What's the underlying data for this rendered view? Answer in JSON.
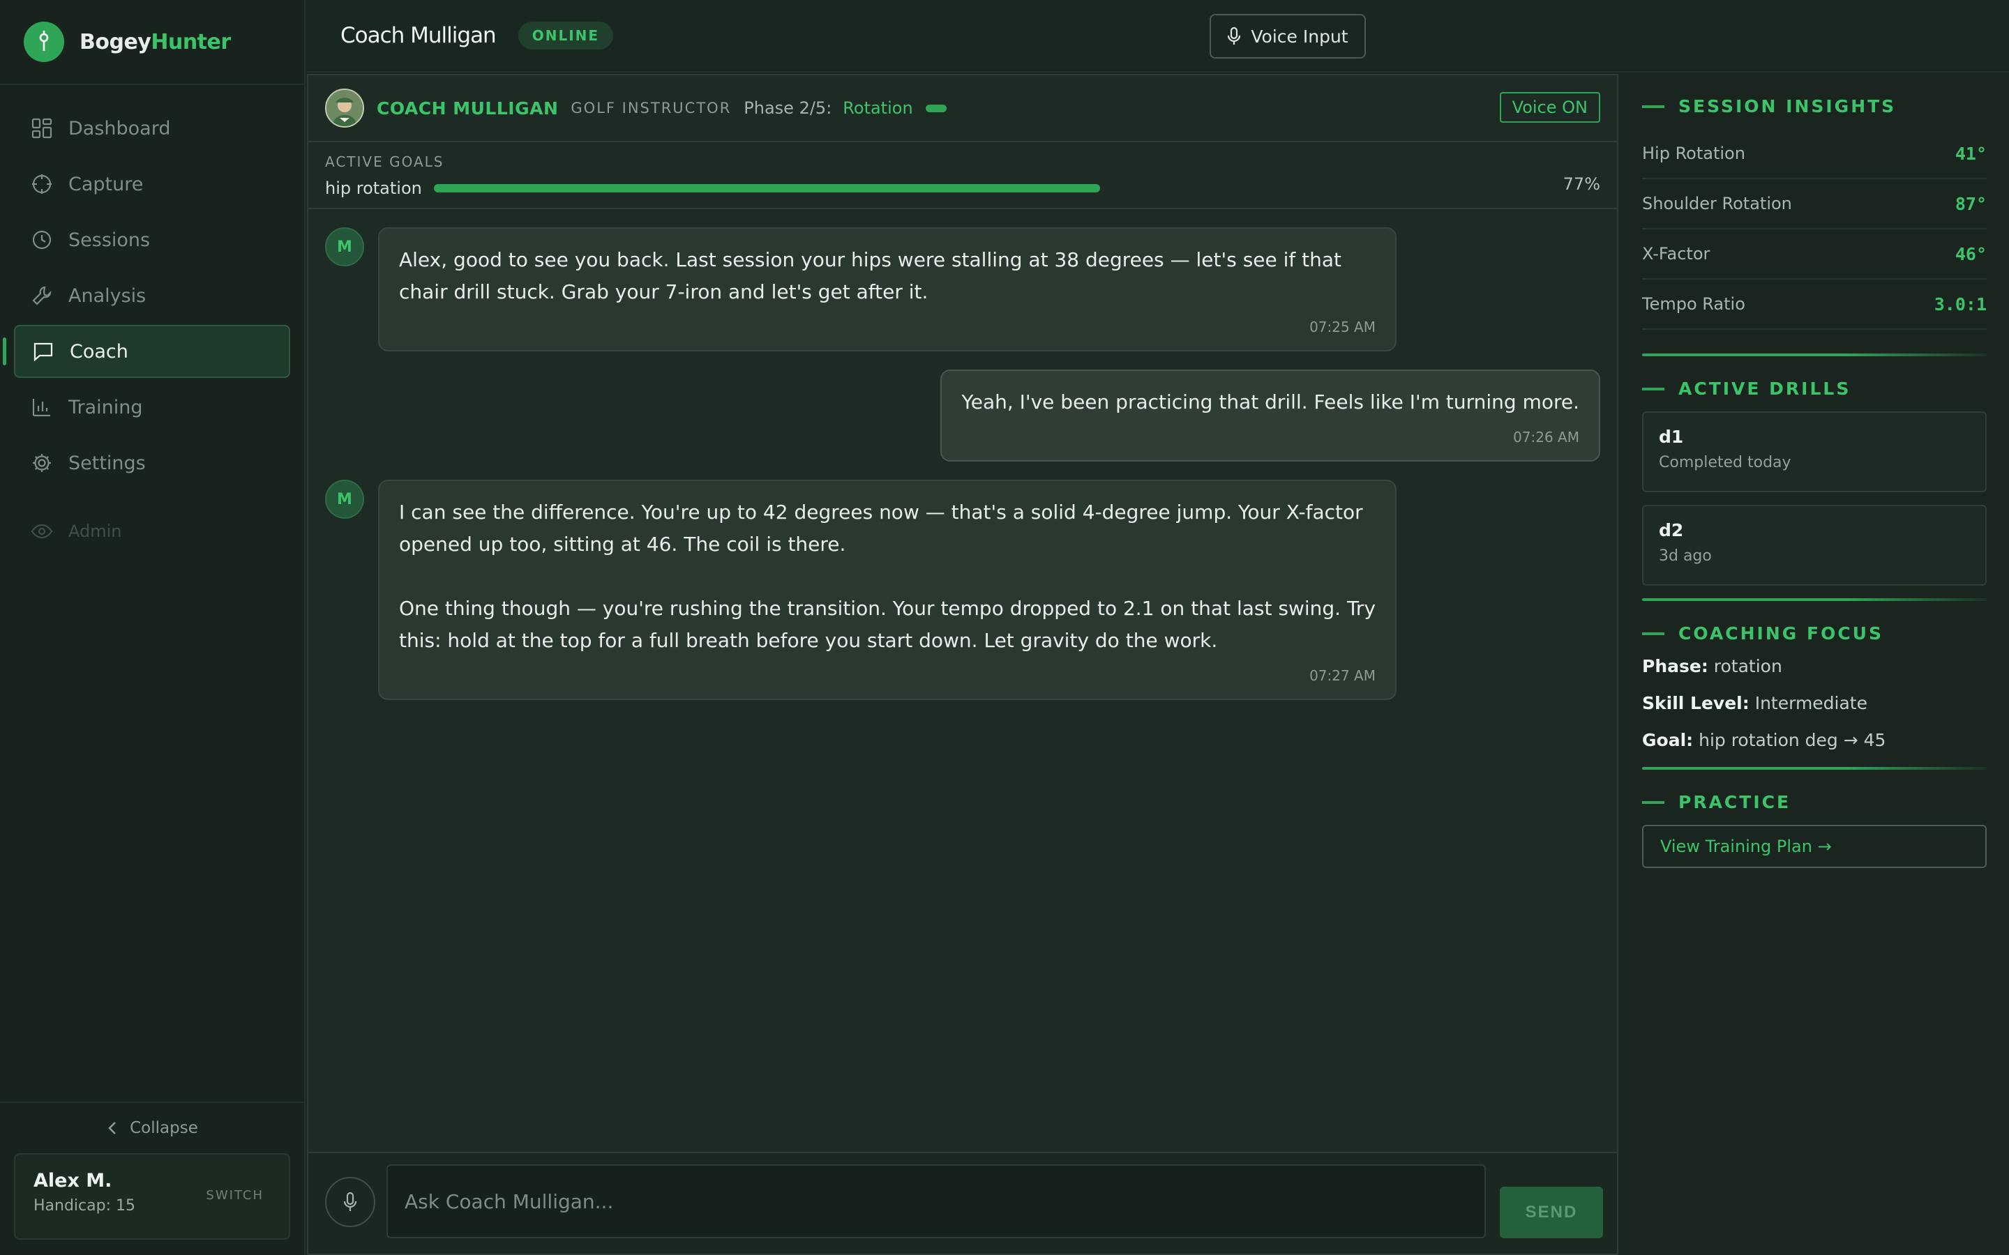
{
  "brand": {
    "part1": "Bogey",
    "part2": "Hunter"
  },
  "nav": [
    {
      "label": "Dashboard",
      "icon": "dashboard-icon"
    },
    {
      "label": "Capture",
      "icon": "crosshair-icon"
    },
    {
      "label": "Sessions",
      "icon": "clock-icon"
    },
    {
      "label": "Analysis",
      "icon": "wrench-icon"
    },
    {
      "label": "Coach",
      "icon": "chat-icon",
      "active": true
    },
    {
      "label": "Training",
      "icon": "bar-chart-icon"
    },
    {
      "label": "Settings",
      "icon": "gear-icon"
    },
    {
      "label": "Admin",
      "icon": "eye-icon"
    }
  ],
  "sidebar": {
    "collapse_label": "Collapse"
  },
  "user": {
    "name": "Alex M.",
    "handicap": "Handicap: 15",
    "switch_label": "SWITCH"
  },
  "topbar": {
    "title": "Coach Mulligan",
    "status": "ONLINE",
    "voice_input_label": "Voice Input"
  },
  "chat_header": {
    "coach_name": "COACH MULLIGAN",
    "role": "GOLF INSTRUCTOR",
    "phase_label": "Phase 2/5:",
    "phase_value": "Rotation",
    "voice_toggle": "Voice ON"
  },
  "goals": {
    "title": "ACTIVE GOALS",
    "items": [
      {
        "label": "hip rotation",
        "progress": 0.77,
        "percent_label": "77%"
      }
    ]
  },
  "messages": [
    {
      "sender": "coach",
      "avatar": "M",
      "paragraphs": [
        "Alex, good to see you back. Last session your hips were stalling at 38 degrees — let's see if that chair drill stuck. Grab your 7-iron and let's get after it."
      ],
      "time": "07:25 AM"
    },
    {
      "sender": "user",
      "paragraphs": [
        "Yeah, I've been practicing that drill. Feels like I'm turning more."
      ],
      "time": "07:26 AM"
    },
    {
      "sender": "coach",
      "avatar": "M",
      "paragraphs": [
        "I can see the difference. You're up to 42 degrees now — that's a solid 4-degree jump. Your X-factor opened up too, sitting at 46. The coil is there.",
        "One thing though — you're rushing the transition. Your tempo dropped to 2.1 on that last swing. Try this: hold at the top for a full breath before you start down. Let gravity do the work."
      ],
      "time": "07:27 AM"
    }
  ],
  "composer": {
    "placeholder": "Ask Coach Mulligan...",
    "send_label": "SEND"
  },
  "insights": {
    "title": "SESSION INSIGHTS",
    "rows": [
      {
        "label": "Hip Rotation",
        "value": "41°"
      },
      {
        "label": "Shoulder Rotation",
        "value": "87°"
      },
      {
        "label": "X-Factor",
        "value": "46°"
      },
      {
        "label": "Tempo Ratio",
        "value": "3.0:1"
      }
    ]
  },
  "drills": {
    "title": "ACTIVE DRILLS",
    "items": [
      {
        "name": "d1",
        "status": "Completed today"
      },
      {
        "name": "d2",
        "status": "3d ago"
      }
    ]
  },
  "focus": {
    "title": "COACHING FOCUS",
    "phase_key": "Phase:",
    "phase_val": "rotation",
    "skill_key": "Skill Level:",
    "skill_val": "Intermediate",
    "goal_key": "Goal:",
    "goal_val": "hip rotation deg → 45"
  },
  "practice": {
    "title": "PRACTICE",
    "plan_label": "View Training Plan →"
  },
  "colors": {
    "accent": "#2ea557",
    "accent_text": "#3cc46a",
    "background": "#1a2620"
  }
}
